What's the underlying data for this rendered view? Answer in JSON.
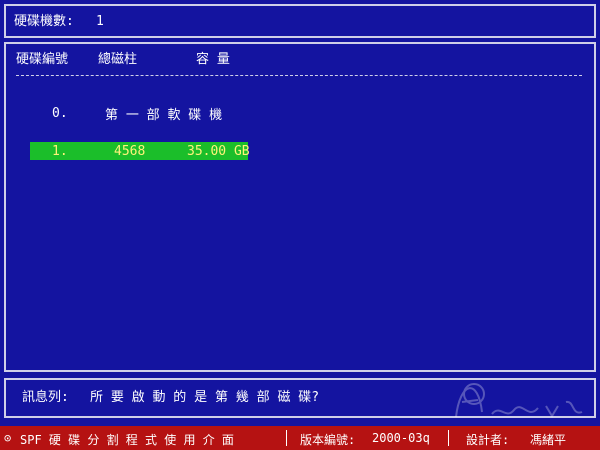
{
  "header": {
    "disk_count_label": "硬碟機數:",
    "disk_count_value": "1"
  },
  "table": {
    "col_id": "硬碟編號",
    "col_cylinders": "總磁柱",
    "col_capacity": "容 量",
    "rows": [
      {
        "id": "0.",
        "name": "第 一 部 軟 碟 機"
      },
      {
        "id": "1.",
        "cylinders": "4568",
        "capacity": "35.00 GB"
      }
    ]
  },
  "message": {
    "label": "訊息列:",
    "text": "所 要 啟 動 的 是 第 幾 部 磁 碟?"
  },
  "status_bar": {
    "copyright_icon": "copyright-icon",
    "app_name": "SPF 硬 碟 分 割 程 式 使 用 介 面",
    "version_label": "版本編號:",
    "version_value": "2000-03q",
    "designer_label": "設計者:",
    "designer_value": "馮緒平"
  },
  "colors": {
    "background": "#1414a0",
    "highlight": "#1bbe2a",
    "highlight_text": "#fff37a",
    "status_bar": "#b51212"
  }
}
